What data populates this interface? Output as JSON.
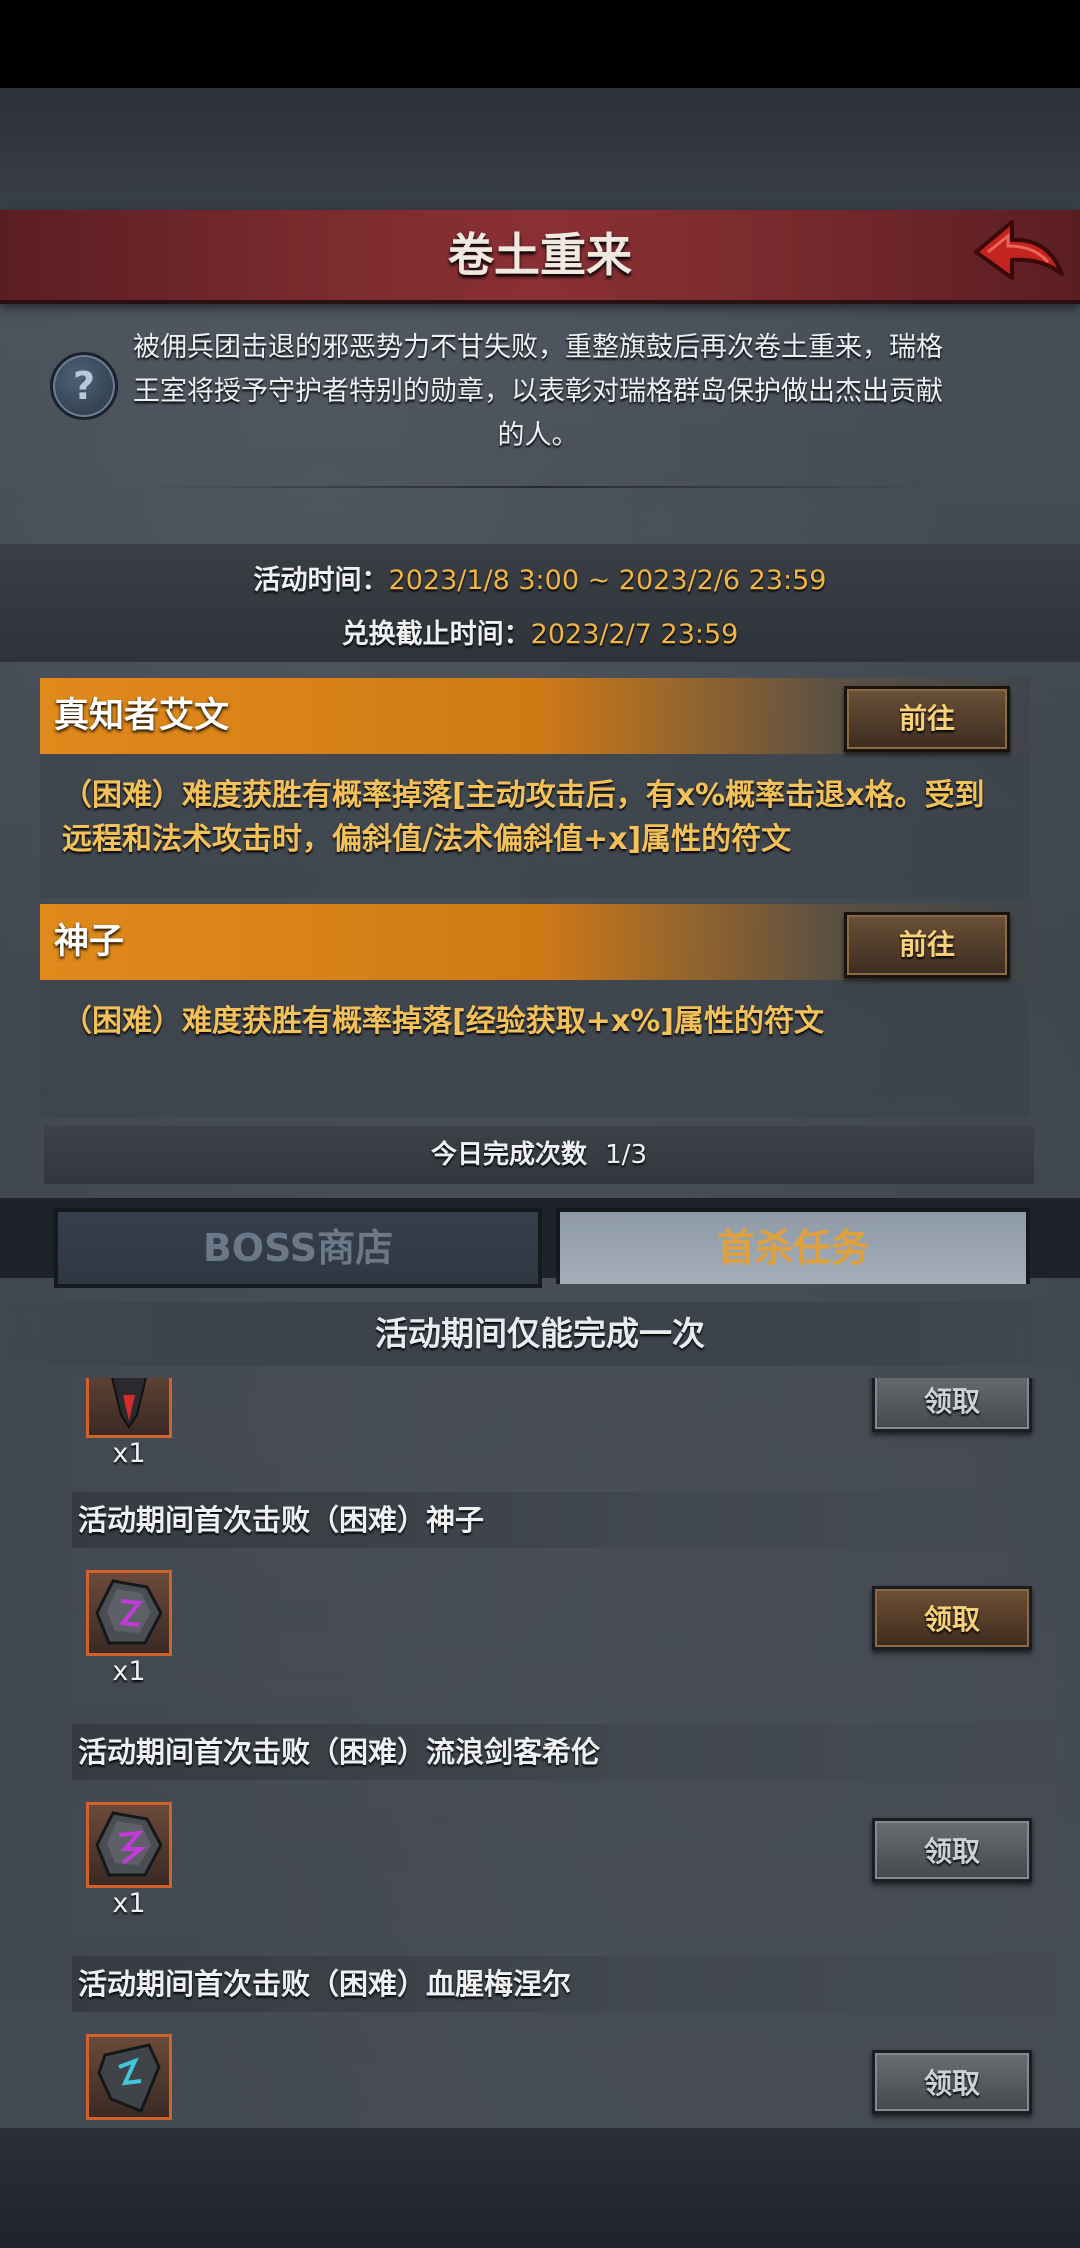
{
  "header": {
    "title": "卷土重来"
  },
  "intro": {
    "text": "被佣兵团击退的邪恶势力不甘失败，重整旗鼓后再次卷土重来，瑞格王室将授予守护者特别的勋章，以表彰对瑞格群岛保护做出杰出贡献的人。"
  },
  "event_time": {
    "activity_label": "活动时间：",
    "activity_value": "2023/1/8 3:00 ~ 2023/2/6 23:59",
    "exchange_label": "兑换截止时间：",
    "exchange_value": "2023/2/7 23:59"
  },
  "bosses": [
    {
      "name": "真知者艾文",
      "button": "前往",
      "desc": "（困难）难度获胜有概率掉落[主动攻击后，有x%概率击退x格。受到远程和法术攻击时，偏斜值/法术偏斜值+x]属性的符文"
    },
    {
      "name": "神子",
      "button": "前往",
      "desc": "（困难）难度获胜有概率掉落[经验获取+x%]属性的符文"
    }
  ],
  "daily": {
    "label": "今日完成次数",
    "value": "1/3"
  },
  "tabs": {
    "boss_shop": "BOSS商店",
    "first_kill": "首杀任务"
  },
  "notice": "活动期间仅能完成一次",
  "quests": [
    {
      "title": "",
      "count": "x1",
      "button": "领取",
      "state": "disabled",
      "icon": "red-rune-icon"
    },
    {
      "title": "活动期间首次击败（困难）神子",
      "count": "x1",
      "button": "领取",
      "state": "active",
      "icon": "purple-rune-icon"
    },
    {
      "title": "活动期间首次击败（困难）流浪剑客希伦",
      "count": "x1",
      "button": "领取",
      "state": "disabled",
      "icon": "purple-rune-icon"
    },
    {
      "title": "活动期间首次击败（困难）血腥梅涅尔",
      "count": "",
      "button": "领取",
      "state": "disabled",
      "icon": "cyan-rune-icon"
    }
  ],
  "colors": {
    "accent_gold": "#f0b544",
    "title_red": "#7b2b2e",
    "orange_header": "#e08a1c"
  }
}
